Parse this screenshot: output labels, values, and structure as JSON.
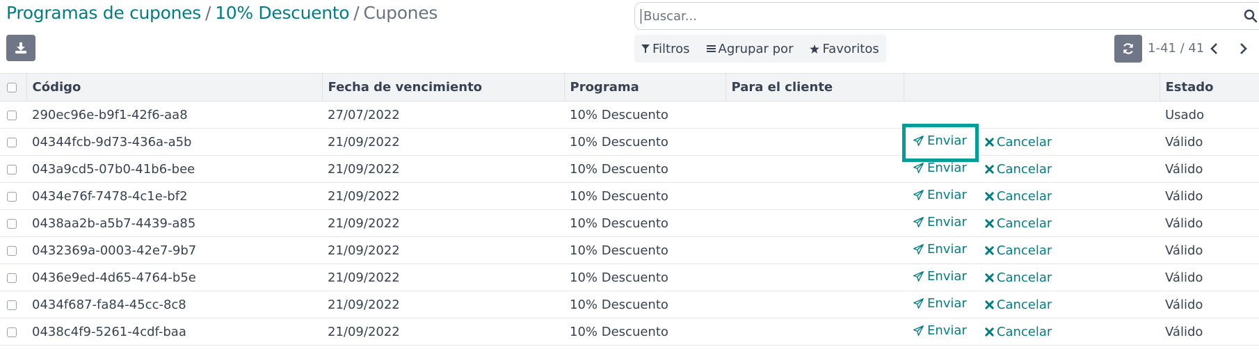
{
  "breadcrumb": {
    "level1": "Programas de cupones",
    "sep": "/",
    "level2": "10% Descuento",
    "current": "Cupones"
  },
  "search": {
    "placeholder": "Buscar..."
  },
  "filters": {
    "filters_label": "Filtros",
    "group_by_label": "Agrupar por",
    "favorites_label": "Favoritos"
  },
  "pager": {
    "value": "1-41 / 41"
  },
  "table": {
    "headers": {
      "code": "Código",
      "expiry": "Fecha de vencimiento",
      "program": "Programa",
      "customer": "Para el cliente",
      "state": "Estado"
    },
    "send_label": "Enviar",
    "cancel_label": "Cancelar",
    "rows": [
      {
        "code": "290ec96e-b9f1-42f6-aa8",
        "expiry": "27/07/2022",
        "program": "10% Descuento",
        "customer": "",
        "state": "Usado"
      },
      {
        "code": "04344fcb-9d73-436a-a5b",
        "expiry": "21/09/2022",
        "program": "10% Descuento",
        "customer": "",
        "state": "Válido"
      },
      {
        "code": "043a9cd5-07b0-41b6-bee",
        "expiry": "21/09/2022",
        "program": "10% Descuento",
        "customer": "",
        "state": "Válido"
      },
      {
        "code": "0434e76f-7478-4c1e-bf2",
        "expiry": "21/09/2022",
        "program": "10% Descuento",
        "customer": "",
        "state": "Válido"
      },
      {
        "code": "0438aa2b-a5b7-4439-a85",
        "expiry": "21/09/2022",
        "program": "10% Descuento",
        "customer": "",
        "state": "Válido"
      },
      {
        "code": "0432369a-0003-42e7-9b7",
        "expiry": "21/09/2022",
        "program": "10% Descuento",
        "customer": "",
        "state": "Válido"
      },
      {
        "code": "0436e9ed-4d65-4764-b5e",
        "expiry": "21/09/2022",
        "program": "10% Descuento",
        "customer": "",
        "state": "Válido"
      },
      {
        "code": "0434f687-fa84-45cc-8c8",
        "expiry": "21/09/2022",
        "program": "10% Descuento",
        "customer": "",
        "state": "Válido"
      },
      {
        "code": "0438c4f9-5261-4cdf-baa",
        "expiry": "21/09/2022",
        "program": "10% Descuento",
        "customer": "",
        "state": "Válido"
      }
    ]
  },
  "colors": {
    "link": "#017e84",
    "highlight": "#019e96",
    "button_bg": "#6f7685"
  },
  "icons": {
    "download": "download-icon",
    "search": "search-icon",
    "filter": "filter-icon",
    "group_by": "list-icon",
    "favorites": "star-icon",
    "refresh": "refresh-icon",
    "prev": "chevron-left-icon",
    "next": "chevron-right-icon",
    "send": "paper-plane-icon",
    "cancel": "times-icon"
  }
}
